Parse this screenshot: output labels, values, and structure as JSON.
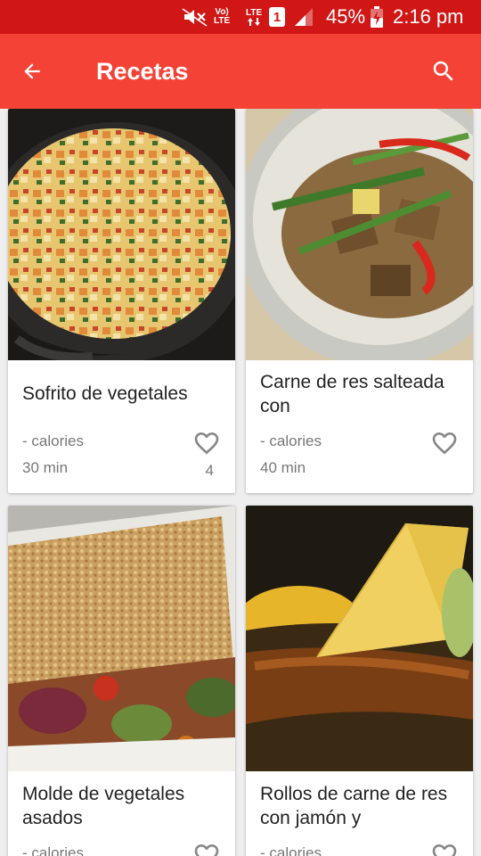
{
  "status_bar": {
    "volte_line1": "Vo)",
    "volte_line2": "LTE",
    "lte_label": "LTE",
    "sim_slot": "1",
    "battery_percent": "45%",
    "time": "2:16 pm",
    "icons": [
      "mute-icon",
      "signal-icon",
      "battery-charging-icon"
    ]
  },
  "app_bar": {
    "title": "Recetas",
    "back_icon": "arrow-back-icon",
    "search_icon": "search-icon"
  },
  "recipes": [
    {
      "title": "Sofrito de vegetales",
      "calories": "- calories",
      "time": "30 min",
      "likes": "4"
    },
    {
      "title": "Carne de res salteada con",
      "calories": "- calories",
      "time": "40 min",
      "likes": ""
    },
    {
      "title": "Molde de vegetales asados",
      "calories": "- calories",
      "time": "",
      "likes": ""
    },
    {
      "title": "Rollos de carne de res con jamón y",
      "calories": "- calories",
      "time": "",
      "likes": ""
    }
  ],
  "colors": {
    "status_bar": "#d01716",
    "app_bar": "#f44336",
    "background": "#eeeeee",
    "card": "#ffffff"
  }
}
